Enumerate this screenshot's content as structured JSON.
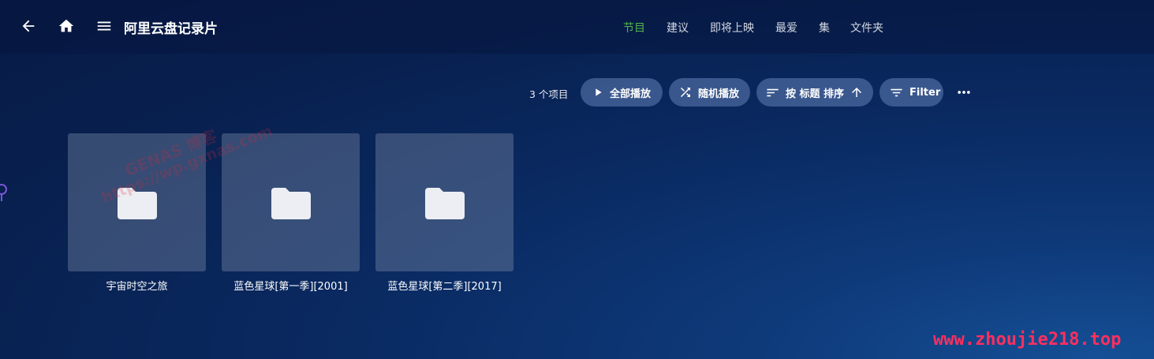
{
  "header": {
    "title": "阿里云盘记录片",
    "tabs": [
      {
        "label": "节目",
        "active": true
      },
      {
        "label": "建议",
        "active": false
      },
      {
        "label": "即将上映",
        "active": false
      },
      {
        "label": "最爱",
        "active": false
      },
      {
        "label": "集",
        "active": false
      },
      {
        "label": "文件夹",
        "active": false
      }
    ],
    "icons": [
      "back-arrow-icon",
      "home-icon",
      "hamburger-menu-icon"
    ]
  },
  "toolbar": {
    "item_count": "3 个项目",
    "play_all_label": "全部播放",
    "shuffle_label": "随机播放",
    "sort_label": "按 标题 排序",
    "filter_label": "Filter",
    "icons": [
      "play-icon",
      "shuffle-icon",
      "sort-icon",
      "arrow-up-icon",
      "filter-icon",
      "more-icon"
    ]
  },
  "items": [
    {
      "title": "宇宙时空之旅",
      "icon": "folder-icon"
    },
    {
      "title": "蓝色星球[第一季][2001]",
      "icon": "folder-icon"
    },
    {
      "title": "蓝色星球[第二季][2017]",
      "icon": "folder-icon"
    }
  ],
  "watermarks": {
    "center_line1": "GENAS 博客",
    "center_line2": "https://wp.gxnas.com",
    "site": "www.zhoujie218.top"
  },
  "colors": {
    "accent_active_tab": "#52b54b",
    "button_bg": "#4e6aa3",
    "site_watermark": "#ff2f5e"
  }
}
